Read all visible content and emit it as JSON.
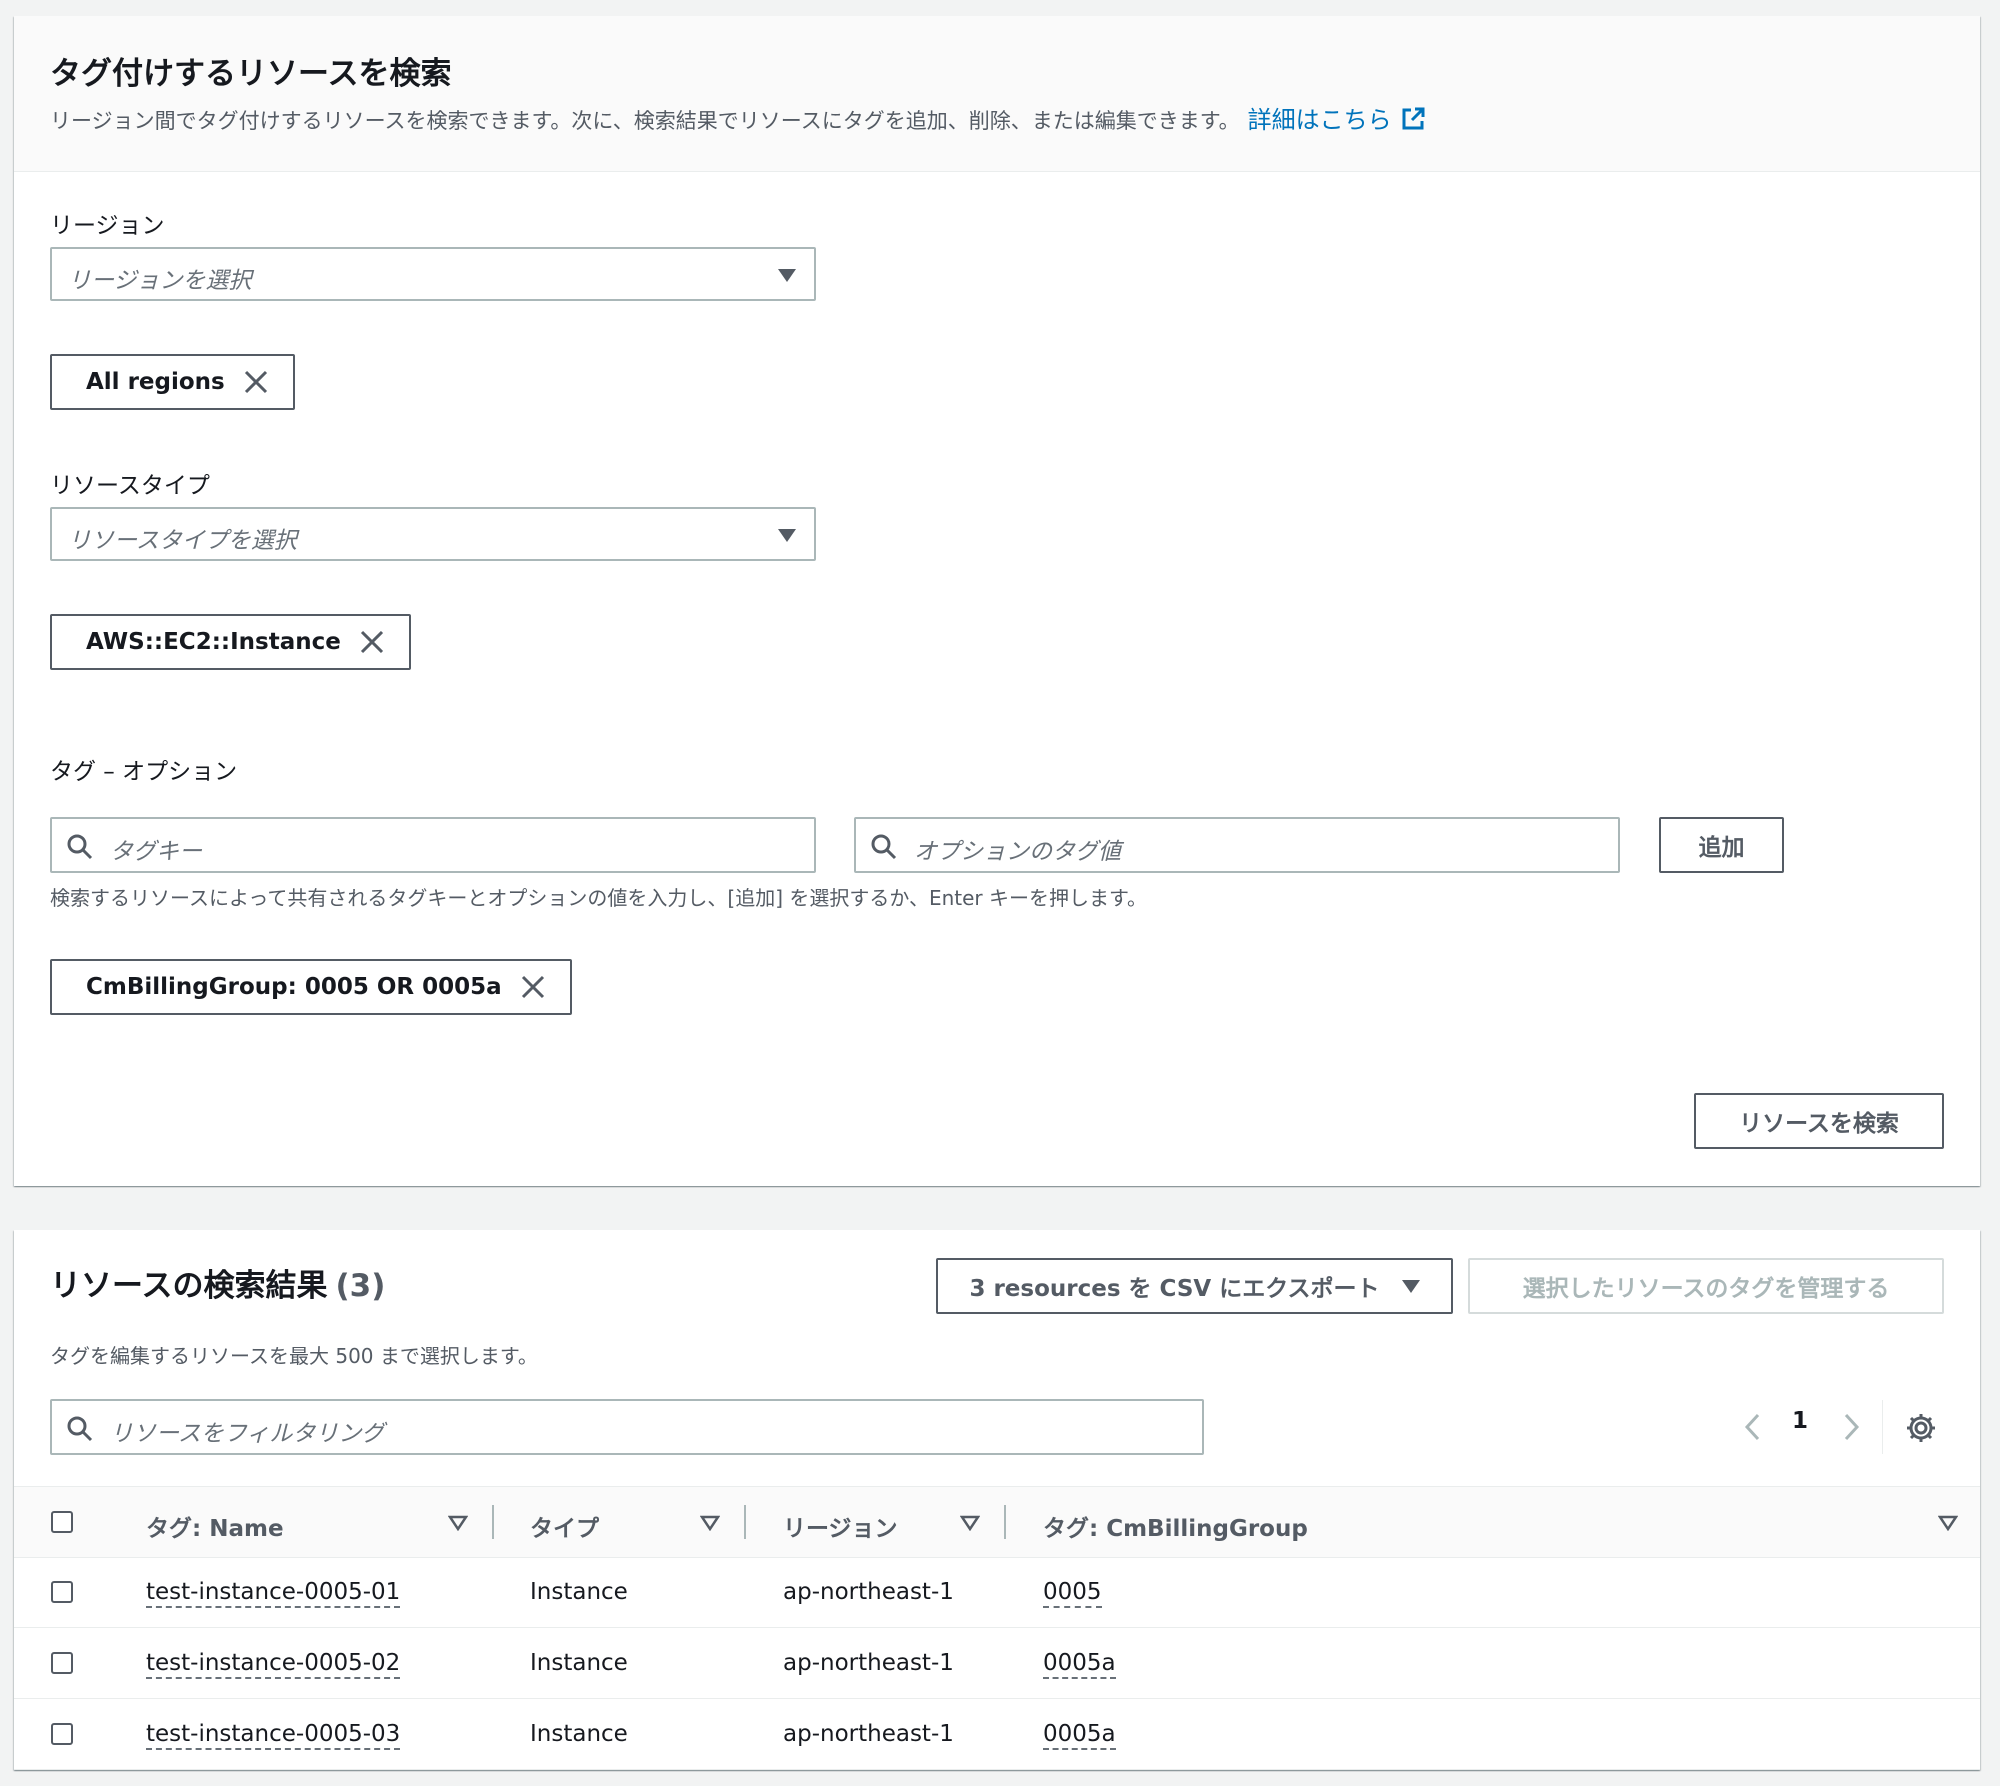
{
  "search_panel": {
    "title": "タグ付けするリソースを検索",
    "description": "リージョン間でタグ付けするリソースを検索できます。次に、検索結果でリソースにタグを追加、削除、または編集できます。",
    "learn_more": "詳細はこちら",
    "region": {
      "label": "リージョン",
      "placeholder": "リージョンを選択",
      "token": "All regions"
    },
    "resource_type": {
      "label": "リソースタイプ",
      "placeholder": "リソースタイプを選択",
      "token": "AWS::EC2::Instance"
    },
    "tags": {
      "label": "タグ – オプション",
      "key_placeholder": "タグキー",
      "value_placeholder": "オプションのタグ値",
      "add_button": "追加",
      "hint": "検索するリソースによって共有されるタグキーとオプションの値を入力し、[追加] を選択するか、Enter キーを押します。",
      "token": "CmBillingGroup: 0005 OR 0005a"
    },
    "search_button": "リソースを検索"
  },
  "results_panel": {
    "title": "リソースの検索結果",
    "count": "(3)",
    "description": "タグを編集するリソースを最大 500 まで選択します。",
    "export_button": "3 resources を CSV にエクスポート",
    "manage_button": "選択したリソースのタグを管理する",
    "filter_placeholder": "リソースをフィルタリング",
    "page_number": "1",
    "columns": [
      "タグ: Name",
      "タイプ",
      "リージョン",
      "タグ: CmBillingGroup"
    ],
    "rows": [
      {
        "name": "test-instance-0005-01",
        "type": "Instance",
        "region": "ap-northeast-1",
        "billing": "0005"
      },
      {
        "name": "test-instance-0005-02",
        "type": "Instance",
        "region": "ap-northeast-1",
        "billing": "0005a"
      },
      {
        "name": "test-instance-0005-03",
        "type": "Instance",
        "region": "ap-northeast-1",
        "billing": "0005a"
      }
    ]
  },
  "colors": {
    "link": "#0073bb",
    "border": "#aab7b8",
    "text": "#16191f",
    "secondary_text": "#545b64"
  },
  "icons": [
    "external-link-icon",
    "close-icon",
    "search-icon",
    "caret-down-icon",
    "chevron-left-icon",
    "chevron-right-icon",
    "gear-icon",
    "sort-icon"
  ]
}
